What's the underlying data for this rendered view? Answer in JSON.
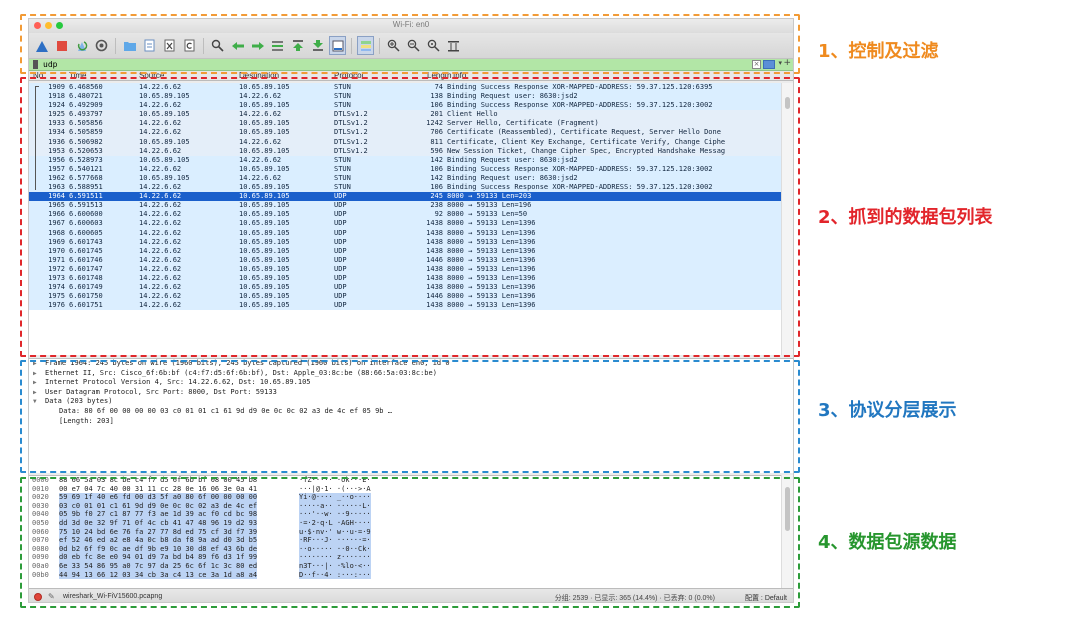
{
  "window": {
    "title": "Wi-Fi: en0"
  },
  "traffic_lights": [
    "#ff5f56",
    "#ffbd2e",
    "#27c93f"
  ],
  "filter": {
    "value": "udp"
  },
  "columns": [
    "No.",
    "Time",
    "Source",
    "Destination",
    "Protocol",
    "Length",
    "Info"
  ],
  "packets": [
    {
      "no": "1909",
      "time": "6.468560",
      "src": "14.22.6.62",
      "dst": "10.65.89.105",
      "proto": "STUN",
      "len": "74",
      "info": "Binding Success Response XOR-MAPPED-ADDRESS: 59.37.125.120:6395"
    },
    {
      "no": "1918",
      "time": "6.480721",
      "src": "10.65.89.105",
      "dst": "14.22.6.62",
      "proto": "STUN",
      "len": "138",
      "info": "Binding Request user: 8630:jsd2"
    },
    {
      "no": "1924",
      "time": "6.492909",
      "src": "14.22.6.62",
      "dst": "10.65.89.105",
      "proto": "STUN",
      "len": "106",
      "info": "Binding Success Response XOR-MAPPED-ADDRESS: 59.37.125.120:3002"
    },
    {
      "no": "1925",
      "time": "6.493797",
      "src": "10.65.89.105",
      "dst": "14.22.6.62",
      "proto": "DTLSv1.2",
      "len": "201",
      "info": "Client Hello"
    },
    {
      "no": "1933",
      "time": "6.505856",
      "src": "14.22.6.62",
      "dst": "10.65.89.105",
      "proto": "DTLSv1.2",
      "len": "1242",
      "info": "Server Hello, Certificate (Fragment)"
    },
    {
      "no": "1934",
      "time": "6.505859",
      "src": "14.22.6.62",
      "dst": "10.65.89.105",
      "proto": "DTLSv1.2",
      "len": "706",
      "info": "Certificate (Reassembled), Certificate Request, Server Hello Done"
    },
    {
      "no": "1936",
      "time": "6.506982",
      "src": "10.65.89.105",
      "dst": "14.22.6.62",
      "proto": "DTLSv1.2",
      "len": "811",
      "info": "Certificate, Client Key Exchange, Certificate Verify, Change Ciphe"
    },
    {
      "no": "1953",
      "time": "6.520653",
      "src": "14.22.6.62",
      "dst": "10.65.89.105",
      "proto": "DTLSv1.2",
      "len": "596",
      "info": "New Session Ticket, Change Cipher Spec, Encrypted Handshake Messag"
    },
    {
      "no": "1956",
      "time": "6.528973",
      "src": "10.65.89.105",
      "dst": "14.22.6.62",
      "proto": "STUN",
      "len": "142",
      "info": "Binding Request user: 8630:jsd2"
    },
    {
      "no": "1957",
      "time": "6.540121",
      "src": "14.22.6.62",
      "dst": "10.65.89.105",
      "proto": "STUN",
      "len": "106",
      "info": "Binding Success Response XOR-MAPPED-ADDRESS: 59.37.125.120:3002"
    },
    {
      "no": "1962",
      "time": "6.577668",
      "src": "10.65.89.105",
      "dst": "14.22.6.62",
      "proto": "STUN",
      "len": "142",
      "info": "Binding Request user: 8630:jsd2"
    },
    {
      "no": "1963",
      "time": "6.588951",
      "src": "14.22.6.62",
      "dst": "10.65.89.105",
      "proto": "STUN",
      "len": "106",
      "info": "Binding Success Response XOR-MAPPED-ADDRESS: 59.37.125.120:3002"
    },
    {
      "no": "1964",
      "time": "6.591511",
      "src": "14.22.6.62",
      "dst": "10.65.89.105",
      "proto": "UDP",
      "len": "245",
      "info": "8000 → 59133 Len=203"
    },
    {
      "no": "1965",
      "time": "6.591513",
      "src": "14.22.6.62",
      "dst": "10.65.89.105",
      "proto": "UDP",
      "len": "238",
      "info": "8000 → 59133 Len=196"
    },
    {
      "no": "1966",
      "time": "6.600600",
      "src": "14.22.6.62",
      "dst": "10.65.89.105",
      "proto": "UDP",
      "len": "92",
      "info": "8000 → 59133 Len=50"
    },
    {
      "no": "1967",
      "time": "6.600603",
      "src": "14.22.6.62",
      "dst": "10.65.89.105",
      "proto": "UDP",
      "len": "1438",
      "info": "8000 → 59133 Len=1396"
    },
    {
      "no": "1968",
      "time": "6.600605",
      "src": "14.22.6.62",
      "dst": "10.65.89.105",
      "proto": "UDP",
      "len": "1438",
      "info": "8000 → 59133 Len=1396"
    },
    {
      "no": "1969",
      "time": "6.601743",
      "src": "14.22.6.62",
      "dst": "10.65.89.105",
      "proto": "UDP",
      "len": "1438",
      "info": "8000 → 59133 Len=1396"
    },
    {
      "no": "1970",
      "time": "6.601745",
      "src": "14.22.6.62",
      "dst": "10.65.89.105",
      "proto": "UDP",
      "len": "1438",
      "info": "8000 → 59133 Len=1396"
    },
    {
      "no": "1971",
      "time": "6.601746",
      "src": "14.22.6.62",
      "dst": "10.65.89.105",
      "proto": "UDP",
      "len": "1446",
      "info": "8000 → 59133 Len=1396"
    },
    {
      "no": "1972",
      "time": "6.601747",
      "src": "14.22.6.62",
      "dst": "10.65.89.105",
      "proto": "UDP",
      "len": "1438",
      "info": "8000 → 59133 Len=1396"
    },
    {
      "no": "1973",
      "time": "6.601748",
      "src": "14.22.6.62",
      "dst": "10.65.89.105",
      "proto": "UDP",
      "len": "1438",
      "info": "8000 → 59133 Len=1396"
    },
    {
      "no": "1974",
      "time": "6.601749",
      "src": "14.22.6.62",
      "dst": "10.65.89.105",
      "proto": "UDP",
      "len": "1438",
      "info": "8000 → 59133 Len=1396"
    },
    {
      "no": "1975",
      "time": "6.601750",
      "src": "14.22.6.62",
      "dst": "10.65.89.105",
      "proto": "UDP",
      "len": "1446",
      "info": "8000 → 59133 Len=1396"
    },
    {
      "no": "1976",
      "time": "6.601751",
      "src": "14.22.6.62",
      "dst": "10.65.89.105",
      "proto": "UDP",
      "len": "1438",
      "info": "8000 → 59133 Len=1396"
    }
  ],
  "selected_packet": "1964",
  "details": [
    {
      "text": "Frame 1964: 245 bytes on wire (1960 bits), 245 bytes captured (1960 bits) on interface en0, id 0",
      "expanded": false,
      "level": 0
    },
    {
      "text": "Ethernet II, Src: Cisco_6f:6b:bf (c4:f7:d5:6f:6b:bf), Dst: Apple_03:8c:be (88:66:5a:03:8c:be)",
      "expanded": false,
      "level": 0
    },
    {
      "text": "Internet Protocol Version 4, Src: 14.22.6.62, Dst: 10.65.89.105",
      "expanded": false,
      "level": 0
    },
    {
      "text": "User Datagram Protocol, Src Port: 8000, Dst Port: 59133",
      "expanded": false,
      "level": 0
    },
    {
      "text": "Data (203 bytes)",
      "expanded": true,
      "level": 0
    },
    {
      "text": "Data: 80 6f 00 00 00 00 03 c0 01 01 c1 61 9d d9 0e 0c 0c 02 a3 de 4c ef 05 9b …",
      "expanded": null,
      "level": 1
    },
    {
      "text": "[Length: 203]",
      "expanded": null,
      "level": 1
    }
  ],
  "bytes": [
    {
      "off": "0000",
      "hex": "88 66 5a 03 8c be c4 f7  d5 6f 6b bf 08 00 45 b8",
      "ascii": "·fZ·····  ·ok···E·"
    },
    {
      "off": "0010",
      "hex": "00 e7 04 7c 40 00 31 11  cc 28 0e 16 06 3e 0a 41",
      "ascii": "···|@·1·  ·(···>·A"
    },
    {
      "off": "0020",
      "hex": "59 69 1f 40 e6 fd 00 d3  5f a0 80 6f 00 00 00 00",
      "ascii": "Yi·@····  _··o····"
    },
    {
      "off": "0030",
      "hex": "03 c0 01 01 c1 61 9d d9  0e 0c 0c 02 a3 de 4c ef",
      "ascii": "·····a··  ······L·"
    },
    {
      "off": "0040",
      "hex": "05 9b f0 27 c1 87 77 f3  ae 1d 39 ac f0 cd bc 98",
      "ascii": "···'··w·  ··9·····"
    },
    {
      "off": "0050",
      "hex": "dd 3d 0e 32 9f 71 0f 4c  cb 41 47 48 96 19 d2 93",
      "ascii": "·=·2·q·L  ·AGH····"
    },
    {
      "off": "0060",
      "hex": "75 10 24 bd 6e 76 fa 27  77 8d ed 75 cf 3d f7 39",
      "ascii": "u·$·nv·'  w··u·=·9"
    },
    {
      "off": "0070",
      "hex": "ef 52 46 ed a2 e8 4a 0c  b8 da f8 9a ad d0 3d b5",
      "ascii": "·RF···J·  ······=·"
    },
    {
      "off": "0080",
      "hex": "0d b2 6f f9 0c ae df 9b  e9 10 30 d8 ef 43 6b de",
      "ascii": "··o·····  ··0··Ck·"
    },
    {
      "off": "0090",
      "hex": "d0 eb fc 8e e0 94 01 d9  7a bd b4 89 f6 d3 1f 99",
      "ascii": "········  z·······"
    },
    {
      "off": "00a0",
      "hex": "6e 33 54 86 95 a0 7c 97  da 25 6c 6f 1c 3c 80 ed",
      "ascii": "n3T···|·  ·%lo·<··"
    },
    {
      "off": "00b0",
      "hex": "44 94 13 66 12 03 34 cb  3a c4 13 ce 3a 1d a8 a4",
      "ascii": "D··f··4·  :···:···"
    }
  ],
  "status": {
    "file": "wireshark_Wi-FiV15600.pcapng",
    "stats": "分组: 2539 · 已显示: 365 (14.4%) · 已丢弃: 0 (0.0%)",
    "profile": "配置 : Default"
  },
  "annotations": {
    "a1": "1、控制及过滤",
    "a2": "2、抓到的数据包列表",
    "a3": "3、协议分层展示",
    "a4": "4、数据包源数据"
  },
  "colors": {
    "annotation_orange": "#ef8a1e",
    "annotation_red": "#e2252b",
    "annotation_blue": "#2177c0",
    "annotation_green": "#27962e",
    "selection": "#1a5fcb",
    "filter_valid": "#b2e6a6"
  },
  "toolbar_icons": [
    "shark-fin-start-icon",
    "stop-icon",
    "restart-icon",
    "options-gear-icon",
    "open-folder-icon",
    "save-file-icon",
    "close-file-icon",
    "reload-icon",
    "find-icon",
    "go-back-icon",
    "go-forward-icon",
    "go-to-packet-icon",
    "go-first-icon",
    "go-last-icon",
    "autoscroll-icon",
    "colorize-icon",
    "zoom-in-icon",
    "zoom-out-icon",
    "zoom-normal-icon",
    "resize-columns-icon"
  ]
}
